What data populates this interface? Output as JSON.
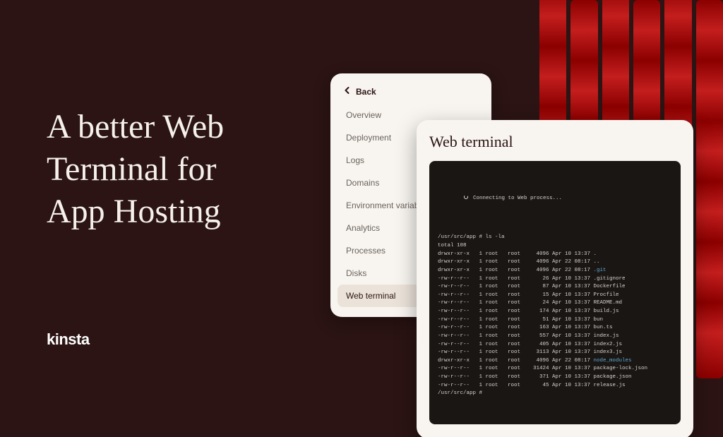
{
  "headline": "A better Web\nTerminal for\nApp Hosting",
  "logo": "kinsta",
  "sidebar": {
    "back_label": "Back",
    "items": [
      "Overview",
      "Deployment",
      "Logs",
      "Domains",
      "Environment variables",
      "Analytics",
      "Processes",
      "Disks",
      "Web terminal"
    ],
    "active_index": 8
  },
  "terminal": {
    "title": "Web terminal",
    "status": "Connecting to Web process...",
    "prompt": "/usr/src/app #",
    "cmd": "ls -la",
    "total": "total 108",
    "rows": [
      {
        "perm": "drwxr-xr-x",
        "n": "1",
        "u": "root",
        "g": "root",
        "size": "4096",
        "date": "Apr 10 13:37",
        "name": ".",
        "cls": ""
      },
      {
        "perm": "drwxr-xr-x",
        "n": "1",
        "u": "root",
        "g": "root",
        "size": "4096",
        "date": "Apr 22 08:17",
        "name": "..",
        "cls": ""
      },
      {
        "perm": "drwxr-xr-x",
        "n": "1",
        "u": "root",
        "g": "root",
        "size": "4096",
        "date": "Apr 22 08:17",
        "name": ".git",
        "cls": "c-blue"
      },
      {
        "perm": "-rw-r--r--",
        "n": "1",
        "u": "root",
        "g": "root",
        "size": "26",
        "date": "Apr 10 13:37",
        "name": ".gitignore",
        "cls": ""
      },
      {
        "perm": "-rw-r--r--",
        "n": "1",
        "u": "root",
        "g": "root",
        "size": "87",
        "date": "Apr 10 13:37",
        "name": "Dockerfile",
        "cls": ""
      },
      {
        "perm": "-rw-r--r--",
        "n": "1",
        "u": "root",
        "g": "root",
        "size": "15",
        "date": "Apr 10 13:37",
        "name": "Procfile",
        "cls": ""
      },
      {
        "perm": "-rw-r--r--",
        "n": "1",
        "u": "root",
        "g": "root",
        "size": "24",
        "date": "Apr 10 13:37",
        "name": "README.md",
        "cls": ""
      },
      {
        "perm": "-rw-r--r--",
        "n": "1",
        "u": "root",
        "g": "root",
        "size": "174",
        "date": "Apr 10 13:37",
        "name": "build.js",
        "cls": ""
      },
      {
        "perm": "-rw-r--r--",
        "n": "1",
        "u": "root",
        "g": "root",
        "size": "51",
        "date": "Apr 10 13:37",
        "name": "bun",
        "cls": ""
      },
      {
        "perm": "-rw-r--r--",
        "n": "1",
        "u": "root",
        "g": "root",
        "size": "163",
        "date": "Apr 10 13:37",
        "name": "bun.ts",
        "cls": ""
      },
      {
        "perm": "-rw-r--r--",
        "n": "1",
        "u": "root",
        "g": "root",
        "size": "557",
        "date": "Apr 10 13:37",
        "name": "index.js",
        "cls": ""
      },
      {
        "perm": "-rw-r--r--",
        "n": "1",
        "u": "root",
        "g": "root",
        "size": "405",
        "date": "Apr 10 13:37",
        "name": "index2.js",
        "cls": ""
      },
      {
        "perm": "-rw-r--r--",
        "n": "1",
        "u": "root",
        "g": "root",
        "size": "3113",
        "date": "Apr 10 13:37",
        "name": "index3.js",
        "cls": ""
      },
      {
        "perm": "drwxr-xr-x",
        "n": "1",
        "u": "root",
        "g": "root",
        "size": "4096",
        "date": "Apr 22 08:17",
        "name": "node_modules",
        "cls": "c-blue"
      },
      {
        "perm": "-rw-r--r--",
        "n": "1",
        "u": "root",
        "g": "root",
        "size": "31424",
        "date": "Apr 10 13:37",
        "name": "package-lock.json",
        "cls": ""
      },
      {
        "perm": "-rw-r--r--",
        "n": "1",
        "u": "root",
        "g": "root",
        "size": "371",
        "date": "Apr 10 13:37",
        "name": "package.json",
        "cls": ""
      },
      {
        "perm": "-rw-r--r--",
        "n": "1",
        "u": "root",
        "g": "root",
        "size": "45",
        "date": "Apr 10 13:37",
        "name": "release.js",
        "cls": ""
      }
    ]
  }
}
